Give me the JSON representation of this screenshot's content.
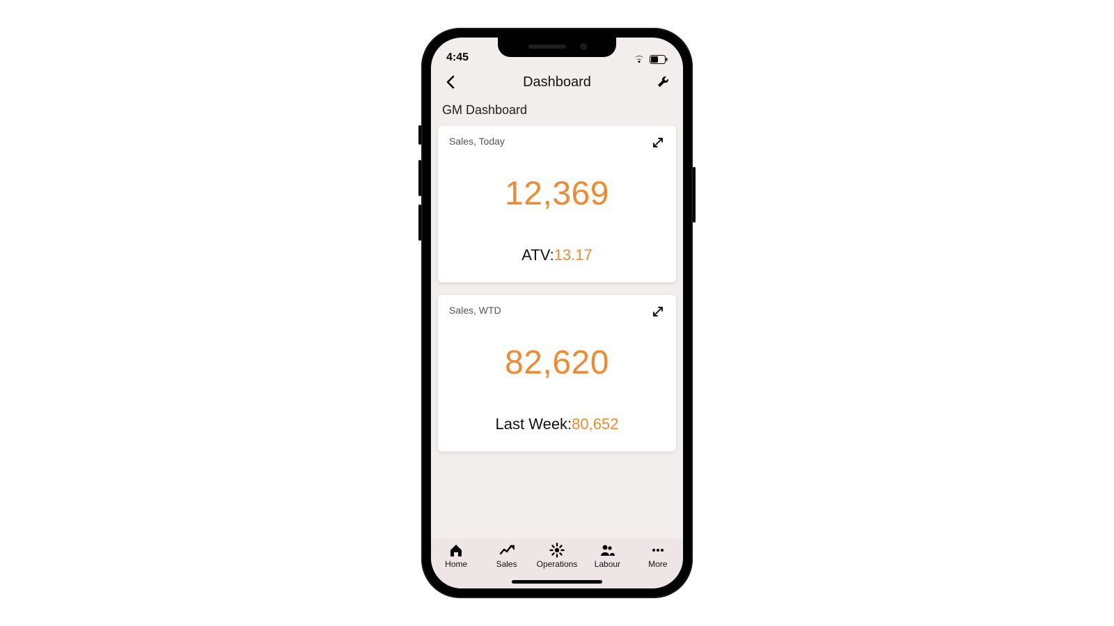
{
  "status": {
    "time": "4:45"
  },
  "nav": {
    "title": "Dashboard"
  },
  "section": {
    "title": "GM Dashboard"
  },
  "cards": [
    {
      "title": "Sales, Today",
      "value": "12,369",
      "sub_label": "ATV:",
      "sub_value": "13.17"
    },
    {
      "title": "Sales, WTD",
      "value": "82,620",
      "sub_label": "Last Week:",
      "sub_value": "80,652"
    }
  ],
  "tabs": [
    {
      "label": "Home"
    },
    {
      "label": "Sales"
    },
    {
      "label": "Operations"
    },
    {
      "label": "Labour"
    },
    {
      "label": "More"
    }
  ],
  "colors": {
    "accent": "#ef8a33"
  }
}
